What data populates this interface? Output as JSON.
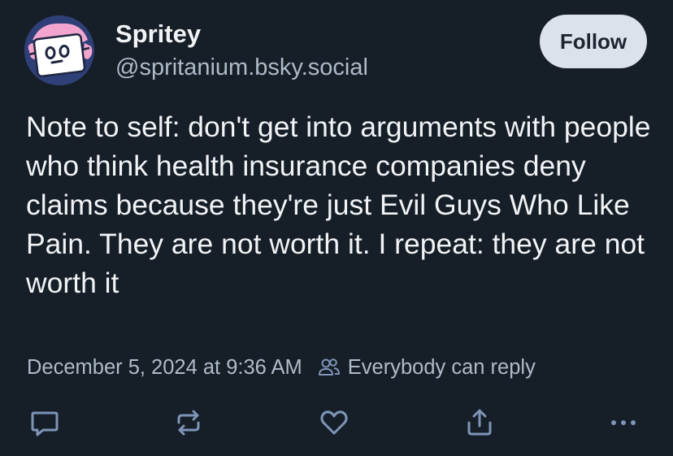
{
  "author": {
    "display_name": "Spritey",
    "handle": "@spritanium.bsky.social"
  },
  "follow_button": {
    "label": "Follow"
  },
  "post": {
    "text": "Note to self: don't get into arguments with people who think health insurance companies deny claims because they're just Evil Guys Who Like Pain. They are not worth it. I repeat: they are not worth it",
    "timestamp": "December 5, 2024 at 9:36 AM",
    "reply_setting": "Everybody can reply"
  },
  "actions": {
    "icons": [
      "reply-icon",
      "repost-icon",
      "like-icon",
      "share-icon",
      "more-icon"
    ]
  },
  "colors": {
    "background": "#161e27",
    "text_primary": "#f1f3f5",
    "text_secondary": "#aebbc9",
    "follow_button_bg": "#dce2ea",
    "action_icon": "#7e95b7"
  }
}
